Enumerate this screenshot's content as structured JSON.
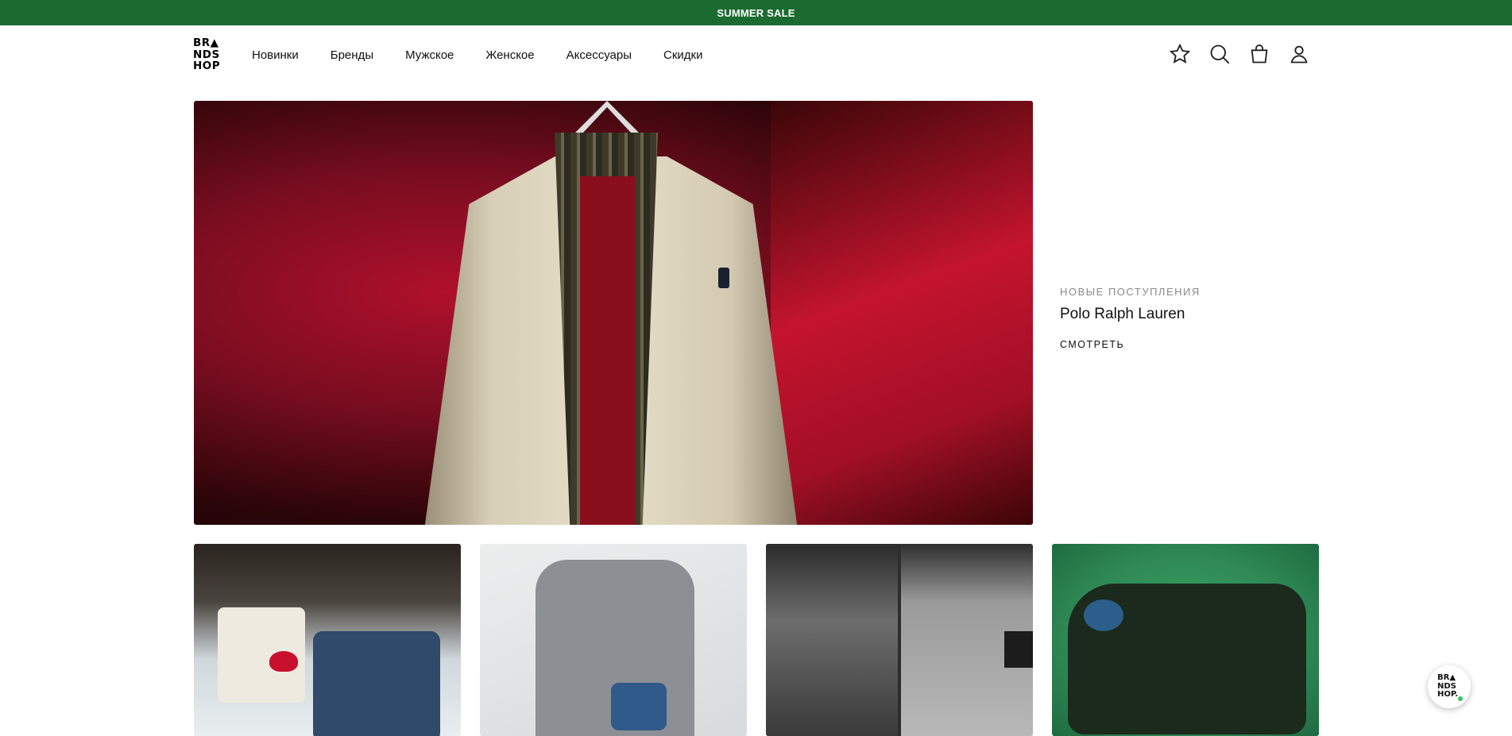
{
  "promo_bar": {
    "text": "SUMMER SALE",
    "color": "#1b6b30"
  },
  "header": {
    "logo_lines": [
      "BR▲",
      "NDS",
      "HOP"
    ],
    "nav": [
      "Новинки",
      "Бренды",
      "Мужское",
      "Женское",
      "Аксессуары",
      "Скидки"
    ],
    "icons": [
      "star-icon",
      "search-icon",
      "bag-icon",
      "user-icon"
    ]
  },
  "hero": {
    "kicker": "НОВЫЕ ПОСТУПЛЕНИЯ",
    "title": "Polo Ralph Lauren",
    "cta": "СМОТРЕТЬ"
  },
  "chat": {
    "logo_lines": [
      "BR▲",
      "NDS",
      "HOP."
    ]
  }
}
